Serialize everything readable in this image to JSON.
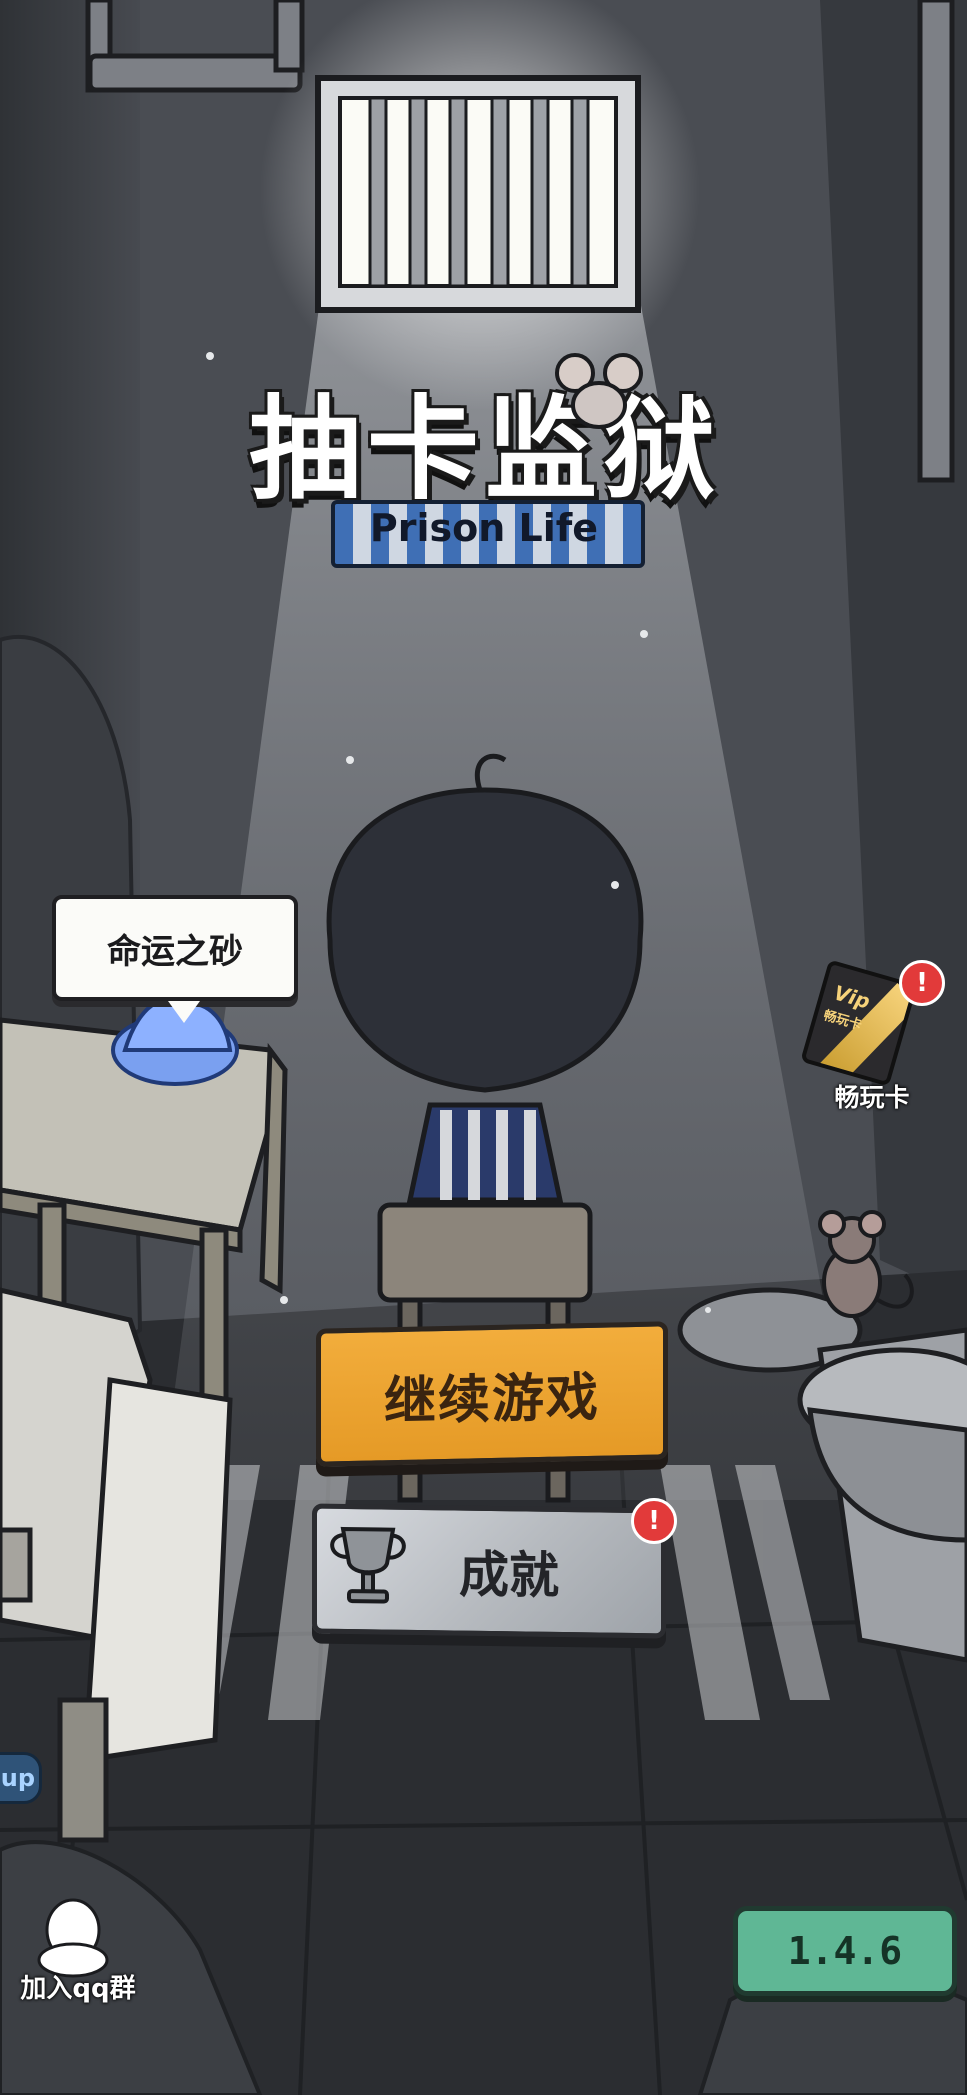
{
  "game": {
    "title_cn": "抽卡监狱",
    "title_en": "Prison Life"
  },
  "hint_bubble": {
    "text": "命运之砂"
  },
  "vip_card": {
    "label": "畅玩卡",
    "card_text": "Vip",
    "card_subtext": "畅玩卡"
  },
  "buttons": {
    "continue_label": "继续游戏",
    "achievements_label": "成就"
  },
  "badges": {
    "symbol": "!"
  },
  "side_tab": {
    "text": "up"
  },
  "qq_group": {
    "label": "加入qq群"
  },
  "version": "1.4.6",
  "colors": {
    "continue_button": "#e9a22f",
    "achievements_button": "#b9bdc2",
    "version_badge": "#5fb795",
    "alert_badge": "#e23a3a"
  }
}
